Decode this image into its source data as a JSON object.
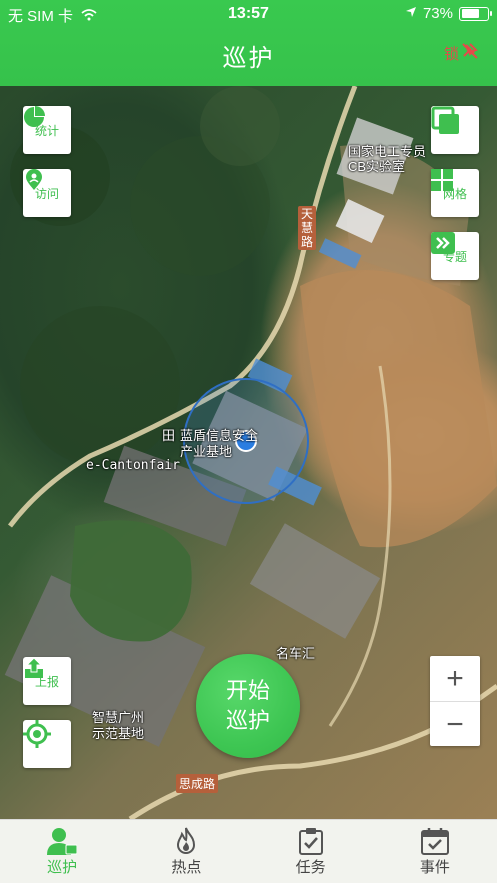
{
  "status_bar": {
    "carrier": "无 SIM 卡",
    "time": "13:57",
    "battery": "73%",
    "battery_level": 0.73
  },
  "header": {
    "title": "巡护",
    "lock_label": "锁"
  },
  "map_controls": {
    "stats_label": "统计",
    "visit_label": "访问",
    "grid_label": "网格",
    "topic_label": "专题",
    "report_label": "上报",
    "zoom_in": "+",
    "zoom_out": "−"
  },
  "map_labels": {
    "lab": "国家电工专员\nCB实验室",
    "lab_line1": "国家电工专员",
    "lab_line2": "CB实验室",
    "road_tianhui": "天慧路",
    "base_line1": "蓝盾信息安全",
    "base_line2": "产业基地",
    "cantonfair": "e-Cantonfair",
    "base_prefix": "田",
    "auto": "名车汇",
    "smart_line1": "智慧广州",
    "smart_line2": "示范基地",
    "road_sicheng": "思成路"
  },
  "start_button": {
    "label": "开始巡护"
  },
  "tabs": [
    {
      "label": "巡护",
      "icon": "patrol-person-icon",
      "active": true
    },
    {
      "label": "热点",
      "icon": "flame-icon",
      "active": false
    },
    {
      "label": "任务",
      "icon": "clipboard-check-icon",
      "active": false
    },
    {
      "label": "事件",
      "icon": "calendar-check-icon",
      "active": false
    }
  ],
  "colors": {
    "accent": "#3fbf4f",
    "header": "#37c44c",
    "lock": "#e54a4a"
  }
}
